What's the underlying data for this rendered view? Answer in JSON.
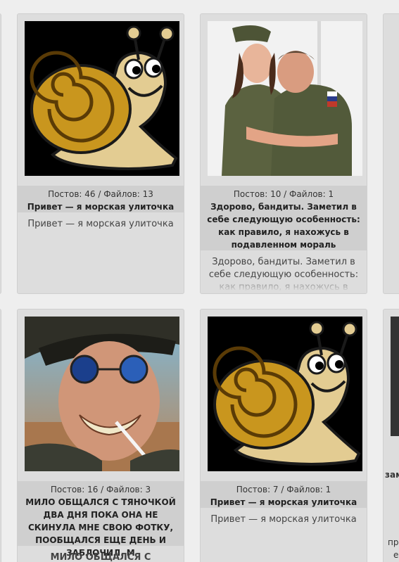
{
  "cards": [
    {
      "counts": "Постов: 46 / Файлов: 13",
      "subject": "Привет — я морская улиточка",
      "message": "Привет — я морская улиточка",
      "image": "snail-image"
    },
    {
      "counts": "Постов: 10 / Файлов: 1",
      "subject": "Здорово, бандиты. Заметил в себе следующую особенность: как правило, я нахожусь в подавленном мораль",
      "message": "Здорово, бандиты. Заметил в себе следующую особенность: как правило, я нахожусь в",
      "image": "military-couple-photo"
    },
    {
      "counts": "Постов: 16 / Файлов: 3",
      "subject": "МИЛО ОБЩАЛСЯ С ТЯНОЧКОЙ ДВА ДНЯ ПОКА ОНА НЕ СКИНУЛА МНЕ СВОЮ ФОТКУ, ПООБЩАЛСЯ ЕЩЕ ДЕНЬ И ЗАБЛОЧИЛ. М",
      "message": "МИЛО ОБЩАЛСЯ С ТЯНОЧКОЙ",
      "image": "smiling-man-sunglasses-photo"
    },
    {
      "counts": "Постов: 7 / Файлов: 1",
      "subject": "Привет — я морская улиточка",
      "message": "Привет — я морская улиточка",
      "image": "snail-image"
    }
  ],
  "partial_right": {
    "line1": "зам",
    "line2": "пр",
    "line3": "е"
  }
}
